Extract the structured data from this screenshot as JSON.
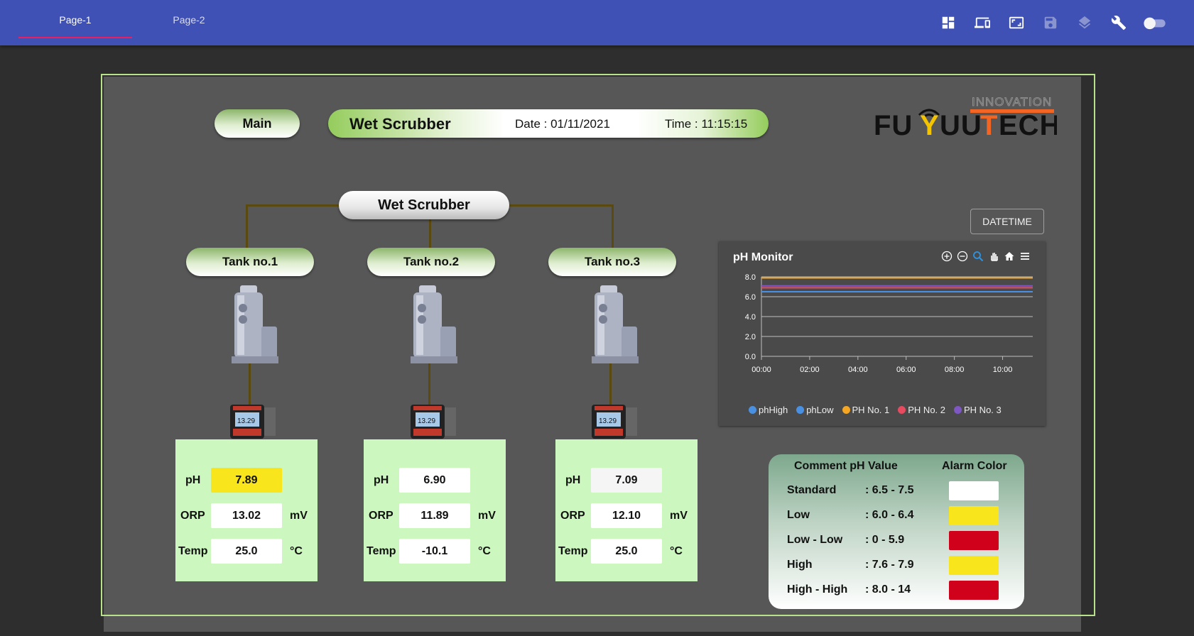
{
  "tabs": [
    {
      "label": "Page-1"
    },
    {
      "label": "Page-2"
    }
  ],
  "toolbar_icons": [
    "dashboard-icon",
    "devices-icon",
    "fullscreen-icon",
    "save-icon",
    "layers-icon",
    "wrench-icon",
    "toggle-icon"
  ],
  "header": {
    "main_label": "Main",
    "title": "Wet Scrubber",
    "date": "Date : 01/11/2021",
    "time": "Time : 11:15:15"
  },
  "logo": {
    "top_text": "INNOVATION",
    "brand": "FUYUUTECH"
  },
  "diagram": {
    "root_label": "Wet Scrubber",
    "tanks": [
      {
        "label": "Tank no.1"
      },
      {
        "label": "Tank no.2"
      },
      {
        "label": "Tank no.3"
      }
    ],
    "meter_reading": "13.29"
  },
  "cards": [
    {
      "ph_label": "pH",
      "ph": "7.89",
      "ph_color": "#f9e51c",
      "orp_label": "ORP",
      "orp": "13.02",
      "orp_unit": "mV",
      "temp_label": "Temp",
      "temp": "25.0",
      "temp_unit": "°C"
    },
    {
      "ph_label": "pH",
      "ph": "6.90",
      "ph_color": "#ffffff",
      "orp_label": "ORP",
      "orp": "11.89",
      "orp_unit": "mV",
      "temp_label": "Temp",
      "temp": "-10.1",
      "temp_unit": "°C"
    },
    {
      "ph_label": "pH",
      "ph": "7.09",
      "ph_color": "#f5f5f5",
      "orp_label": "ORP",
      "orp": "12.10",
      "orp_unit": "mV",
      "temp_label": "Temp",
      "temp": "25.0",
      "temp_unit": "°C"
    }
  ],
  "datetime_button": "DATETIME",
  "chart_tools": [
    "zoom-in-icon",
    "zoom-out-icon",
    "zoom-select-icon",
    "pan-icon",
    "home-icon",
    "menu-icon"
  ],
  "chart_data": {
    "type": "line",
    "title": "pH Monitor",
    "x": [
      "00:00",
      "02:00",
      "04:00",
      "06:00",
      "08:00",
      "10:00"
    ],
    "x_range": [
      "00:00",
      "11:15"
    ],
    "ylim": [
      0,
      8
    ],
    "y_ticks": [
      "0.0",
      "2.0",
      "4.0",
      "6.0",
      "8.0"
    ],
    "grid": true,
    "legend_position": "bottom",
    "series": [
      {
        "name": "phHigh",
        "color": "#4a90e2",
        "value": 7.9
      },
      {
        "name": "phLow",
        "color": "#4a90e2",
        "value": 6.5
      },
      {
        "name": "PH No. 1",
        "color": "#f5a623",
        "value": 7.89
      },
      {
        "name": "PH No. 2",
        "color": "#e84a5f",
        "value": 6.9
      },
      {
        "name": "PH No. 3",
        "color": "#7e57c2",
        "value": 7.09
      }
    ]
  },
  "alarm_table": {
    "col1": "Comment pH Value",
    "col2": "Alarm Color",
    "rows": [
      {
        "name": "Standard",
        "range": ": 6.5 - 7.5",
        "color": "#ffffff"
      },
      {
        "name": "Low",
        "range": ": 6.0 - 6.4",
        "color": "#f9e51c"
      },
      {
        "name": "Low - Low",
        "range": ": 0 - 5.9",
        "color": "#d0021b"
      },
      {
        "name": "High",
        "range": ": 7.6 - 7.9",
        "color": "#f9e51c"
      },
      {
        "name": "High - High",
        "range": ": 8.0 - 14",
        "color": "#d0021b"
      }
    ]
  }
}
